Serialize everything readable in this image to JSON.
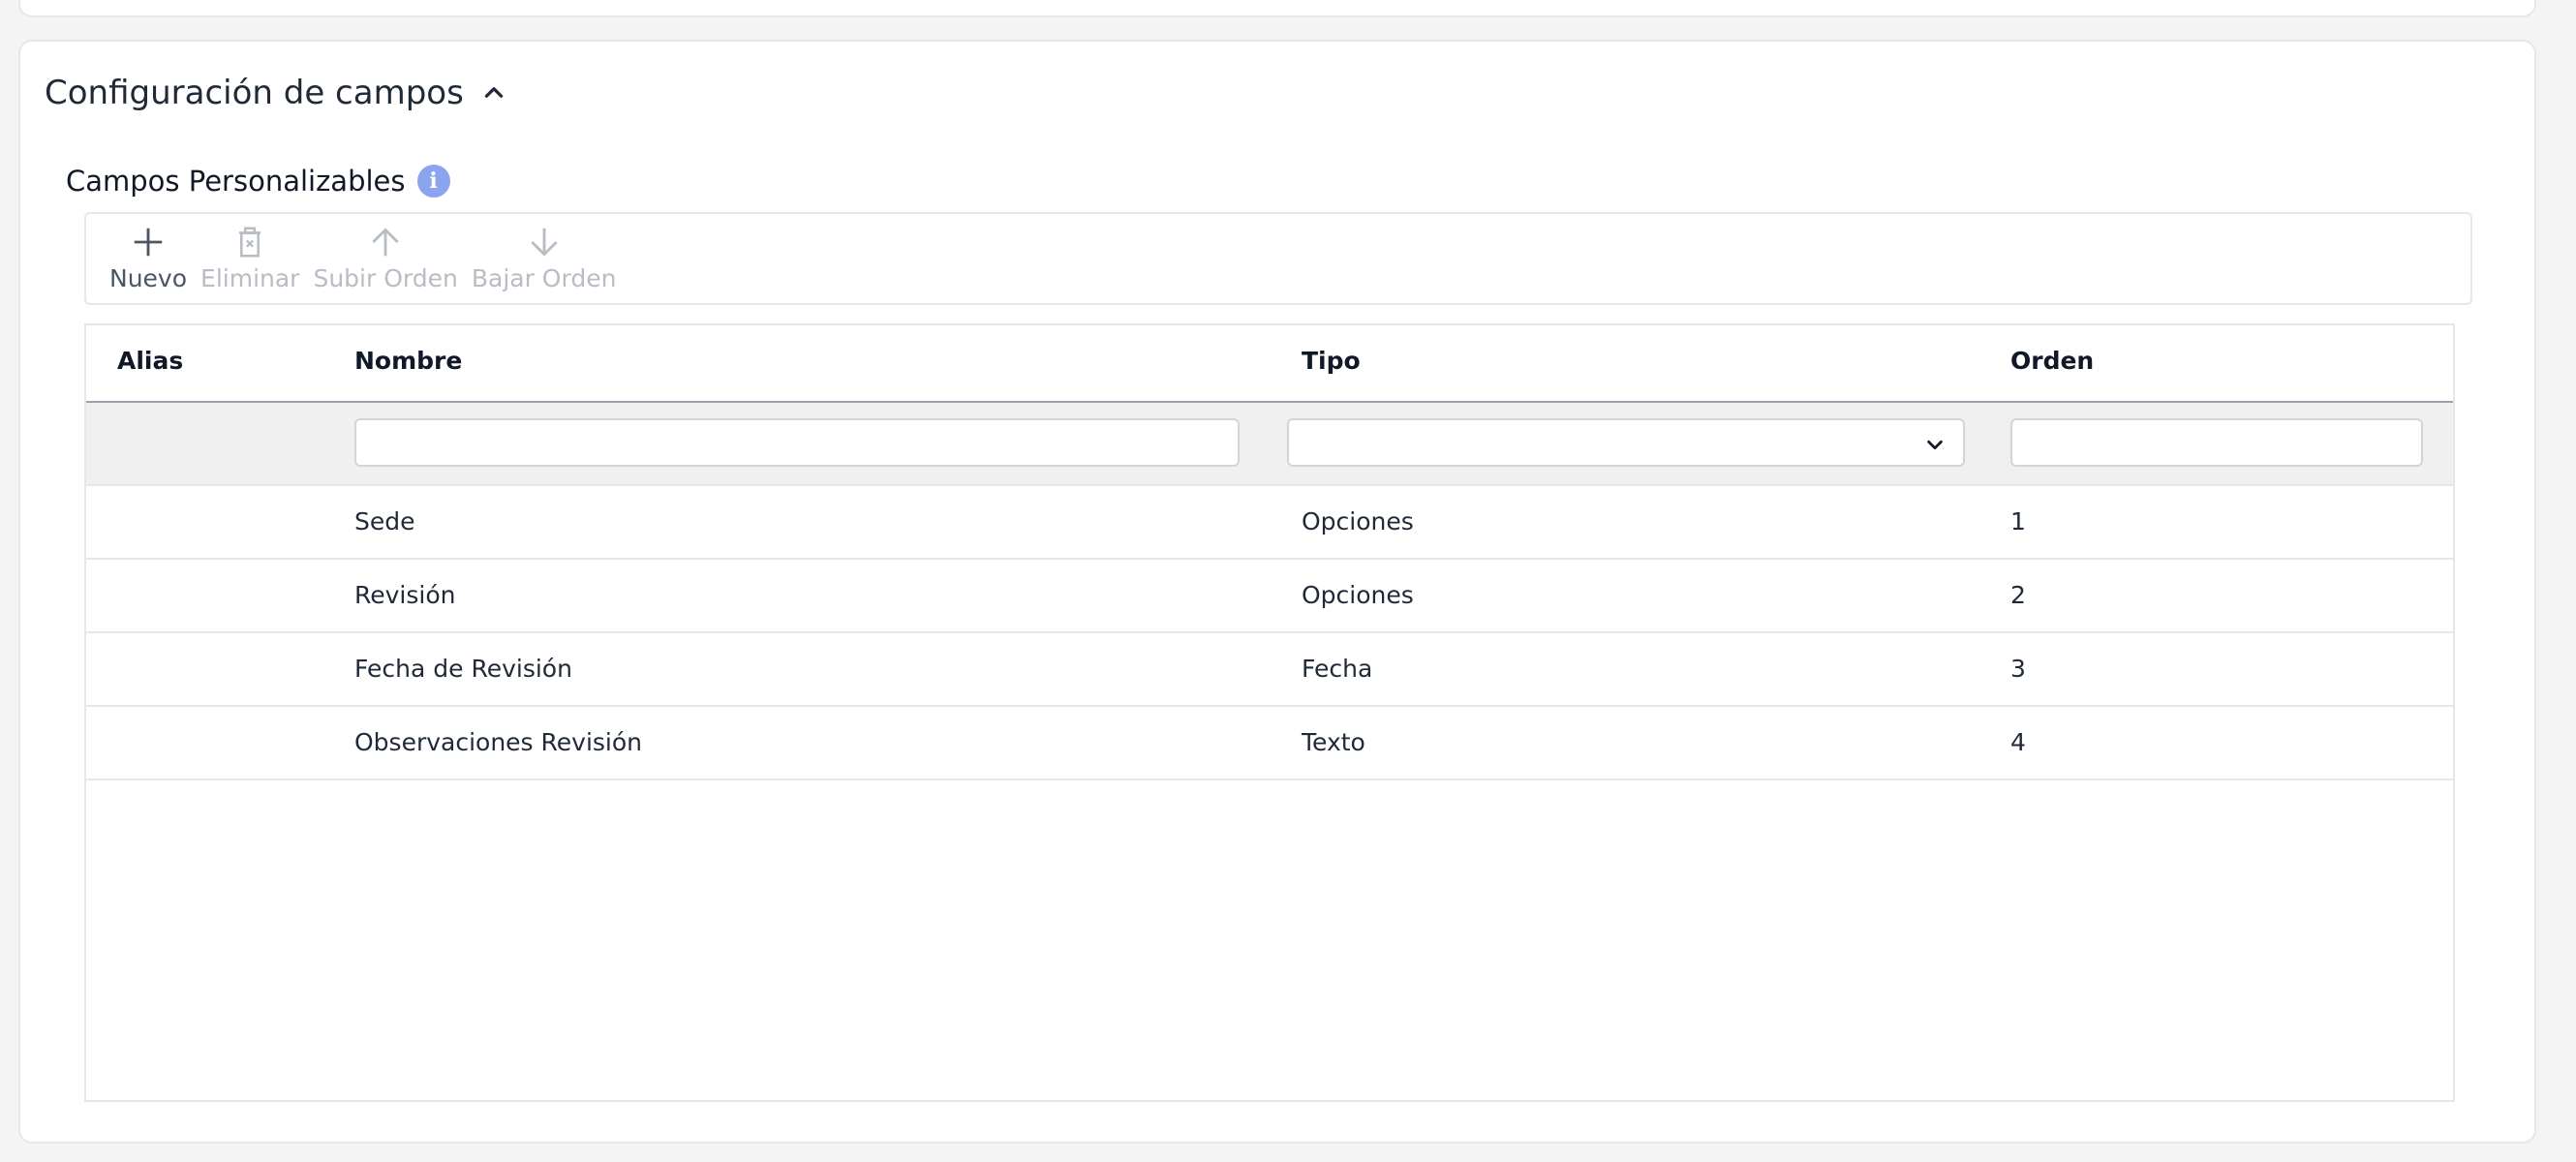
{
  "section": {
    "title": "Configuración de campos"
  },
  "subsection": {
    "title": "Campos Personalizables",
    "info_icon": "info-icon"
  },
  "toolbar": {
    "new_label": "Nuevo",
    "delete_label": "Eliminar",
    "up_label": "Subir Orden",
    "down_label": "Bajar Orden"
  },
  "grid": {
    "columns": {
      "alias": "Alias",
      "nombre": "Nombre",
      "tipo": "Tipo",
      "orden": "Orden"
    },
    "filters": {
      "nombre": "",
      "tipo": "",
      "orden": ""
    },
    "rows": [
      {
        "alias": "",
        "nombre": "Sede",
        "tipo": "Opciones",
        "orden": "1"
      },
      {
        "alias": "",
        "nombre": "Revisión",
        "tipo": "Opciones",
        "orden": "2"
      },
      {
        "alias": "",
        "nombre": "Fecha de Revisión",
        "tipo": "Fecha",
        "orden": "3"
      },
      {
        "alias": "",
        "nombre": "Observaciones Revisión",
        "tipo": "Texto",
        "orden": "4"
      }
    ]
  },
  "colors": {
    "accent_info": "#8aa5ee",
    "disabled_text": "#b8bcc4",
    "enabled_text": "#4b5563",
    "filter_row_bg": "#f0f0f0"
  }
}
